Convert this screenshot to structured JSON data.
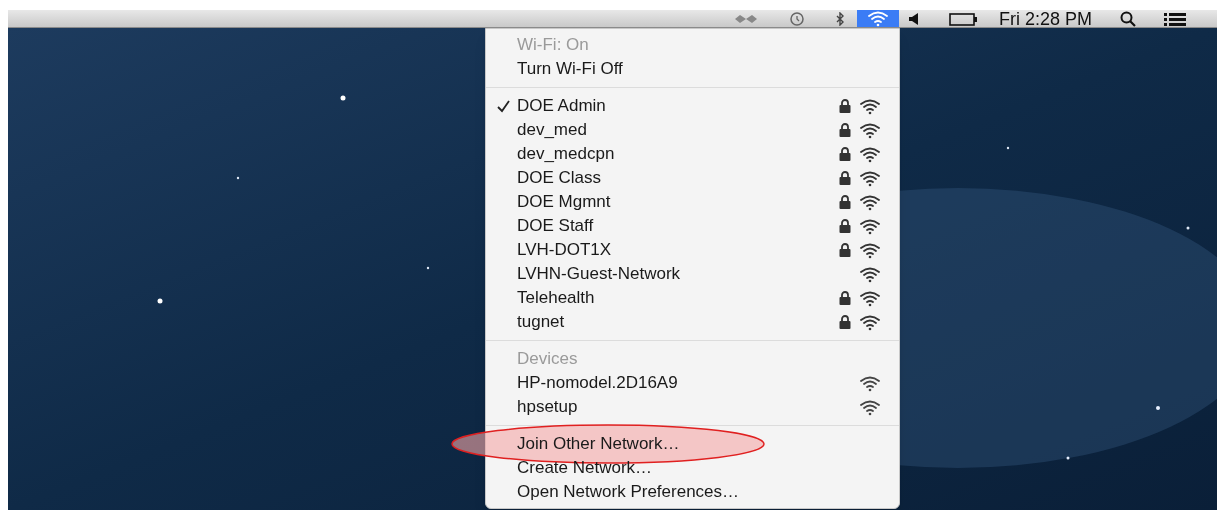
{
  "menu_bar": {
    "wifi_selected": true,
    "clock": "Fri 2:28 PM"
  },
  "wifi_menu": {
    "status": "Wi-Fi: On",
    "toggle": "Turn Wi-Fi Off",
    "networks": [
      {
        "name": "DOE Admin",
        "selected": true,
        "locked": true
      },
      {
        "name": "dev_med",
        "selected": false,
        "locked": true
      },
      {
        "name": "dev_medcpn",
        "selected": false,
        "locked": true
      },
      {
        "name": "DOE Class",
        "selected": false,
        "locked": true
      },
      {
        "name": "DOE Mgmnt",
        "selected": false,
        "locked": true
      },
      {
        "name": "DOE Staff",
        "selected": false,
        "locked": true
      },
      {
        "name": "LVH-DOT1X",
        "selected": false,
        "locked": true
      },
      {
        "name": "LVHN-Guest-Network",
        "selected": false,
        "locked": false
      },
      {
        "name": "Telehealth",
        "selected": false,
        "locked": true
      },
      {
        "name": "tugnet",
        "selected": false,
        "locked": true
      }
    ],
    "devices_heading": "Devices",
    "devices": [
      {
        "name": "HP-nomodel.2D16A9"
      },
      {
        "name": "hpsetup"
      }
    ],
    "actions": [
      {
        "label": "Join Other Network…",
        "highlighted": true
      },
      {
        "label": "Create Network…",
        "highlighted": false
      },
      {
        "label": "Open Network Preferences…",
        "highlighted": false
      }
    ]
  }
}
